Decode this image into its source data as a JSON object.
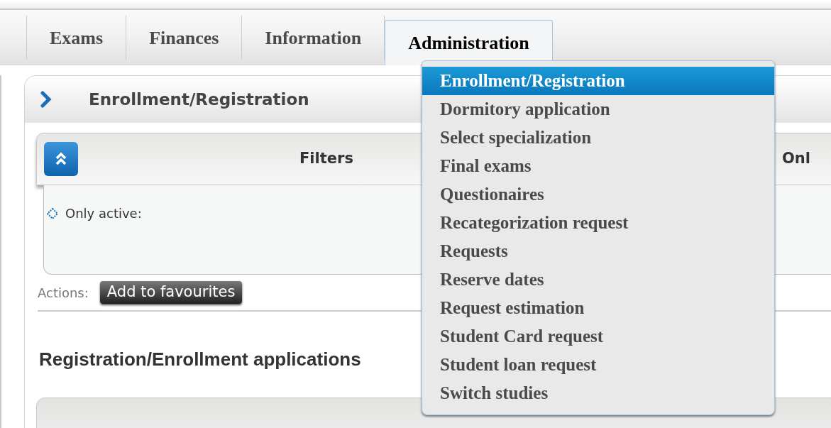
{
  "tabs": [
    {
      "label": "Exams",
      "selected": false
    },
    {
      "label": "Finances",
      "selected": false
    },
    {
      "label": "Information",
      "selected": false
    },
    {
      "label": "Administration",
      "selected": true
    }
  ],
  "menu": {
    "items": [
      {
        "label": "Enrollment/Registration",
        "selected": true
      },
      {
        "label": "Dormitory application",
        "selected": false
      },
      {
        "label": "Select specialization",
        "selected": false
      },
      {
        "label": "Final exams",
        "selected": false
      },
      {
        "label": "Questionaires",
        "selected": false
      },
      {
        "label": "Recategorization request",
        "selected": false
      },
      {
        "label": "Requests",
        "selected": false
      },
      {
        "label": "Reserve dates",
        "selected": false
      },
      {
        "label": "Request estimation",
        "selected": false
      },
      {
        "label": "Student Card request",
        "selected": false
      },
      {
        "label": "Student loan request",
        "selected": false
      },
      {
        "label": "Switch studies",
        "selected": false
      }
    ]
  },
  "panel": {
    "title": "Enrollment/Registration",
    "filters": {
      "title": "Filters",
      "column_2": "Onl",
      "items": [
        "Only active:"
      ]
    },
    "actions": {
      "label": "Actions:",
      "buttons": [
        "Add to favourites"
      ]
    },
    "section_title": "Registration/Enrollment applications"
  }
}
